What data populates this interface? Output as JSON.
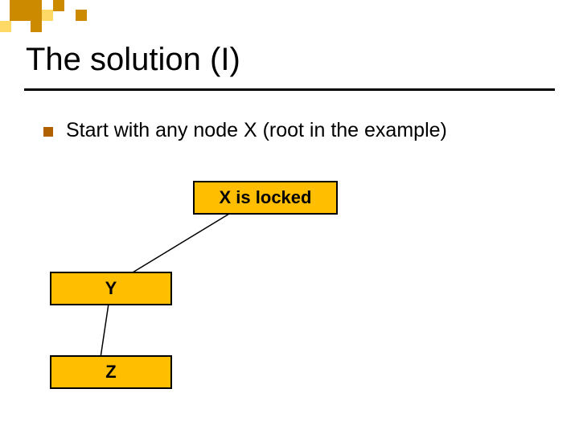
{
  "slide": {
    "title": "The solution (I)",
    "bullet": "Start with any node X (root in the example)",
    "nodes": {
      "x": "X is locked",
      "y": "Y",
      "z": "Z"
    }
  },
  "colors": {
    "square_dark": "#cc8a00",
    "square_light": "#ffd966",
    "node_fill": "#ffbf00",
    "bullet_fill": "#b06000"
  }
}
